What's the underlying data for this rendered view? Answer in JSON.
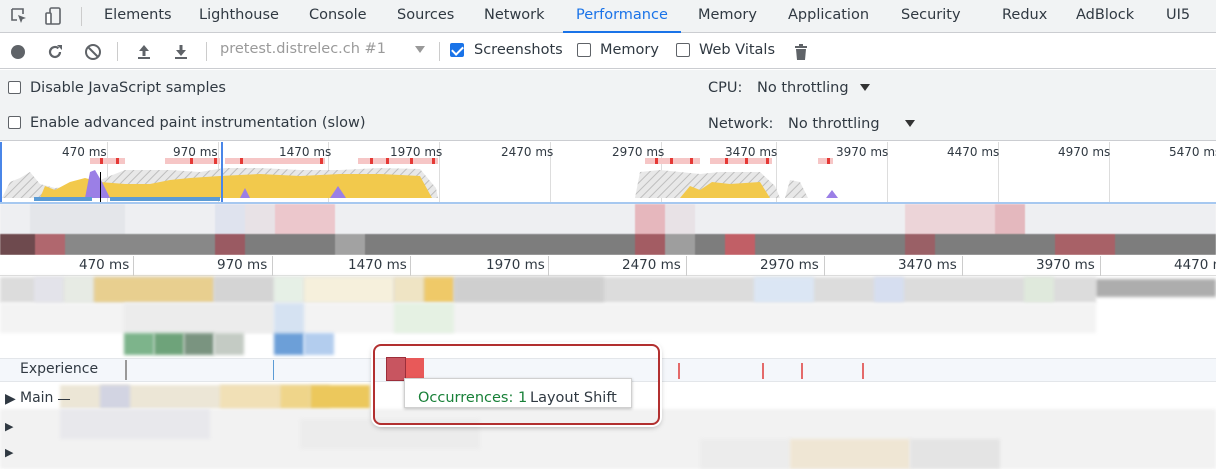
{
  "tabs": [
    {
      "label": "Elements",
      "active": false
    },
    {
      "label": "Lighthouse",
      "active": false
    },
    {
      "label": "Console",
      "active": false
    },
    {
      "label": "Sources",
      "active": false
    },
    {
      "label": "Network",
      "active": false
    },
    {
      "label": "Performance",
      "active": true
    },
    {
      "label": "Memory",
      "active": false
    },
    {
      "label": "Application",
      "active": false
    },
    {
      "label": "Security",
      "active": false
    },
    {
      "label": "Redux",
      "active": false
    },
    {
      "label": "AdBlock",
      "active": false
    },
    {
      "label": "UI5",
      "active": false
    }
  ],
  "toolbar": {
    "recording": "pretest.distrelec.ch #1",
    "screenshots_label": "Screenshots",
    "screenshots_checked": true,
    "memory_label": "Memory",
    "memory_checked": false,
    "web_vitals_label": "Web Vitals",
    "web_vitals_checked": false
  },
  "settings": {
    "disable_js_samples": "Disable JavaScript samples",
    "advanced_paint": "Enable advanced paint instrumentation (slow)",
    "cpu_label": "CPU:",
    "cpu_value": "No throttling",
    "network_label": "Network:",
    "network_value": "No throttling"
  },
  "overview": {
    "ticks": [
      "470 ms",
      "970 ms",
      "1470 ms",
      "1970 ms",
      "2470 ms",
      "2970 ms",
      "3470 ms",
      "3970 ms",
      "4470 ms",
      "4970 ms",
      "5470 ms"
    ]
  },
  "flamechart": {
    "ticks": [
      "470 ms",
      "970 ms",
      "1470 ms",
      "1970 ms",
      "2470 ms",
      "2970 ms",
      "3470 ms",
      "3970 ms",
      "4470 ms"
    ],
    "tracks": {
      "experience": "Experience",
      "main": "Main"
    }
  },
  "tooltip": {
    "occurrences": "Occurrences: 1",
    "name": "Layout Shift"
  },
  "colors": {
    "accent": "#1a73e8",
    "layout_shift": "#e85959",
    "scripting": "#f2c94c",
    "rendering": "#9b7fe6",
    "highlight": "#b23030"
  }
}
